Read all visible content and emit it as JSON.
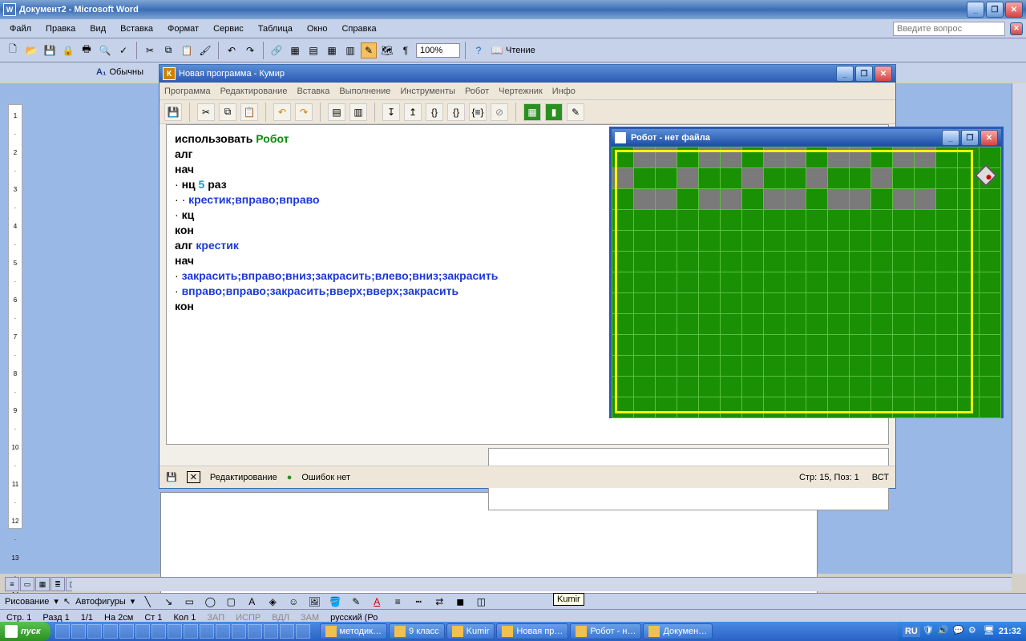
{
  "word": {
    "title": "Документ2 - Microsoft Word",
    "menus": [
      "Файл",
      "Правка",
      "Вид",
      "Вставка",
      "Формат",
      "Сервис",
      "Таблица",
      "Окно",
      "Справка"
    ],
    "help_placeholder": "Введите вопрос",
    "zoom": "100%",
    "reading": "Чтение",
    "format_style": "Обычны",
    "draw_label": "Рисование",
    "draw_autoshapes": "Автофигуры",
    "status": {
      "page": "Стр. 1",
      "sec": "Разд 1",
      "pages": "1/1",
      "at": "На 2см",
      "line": "Ст 1",
      "col": "Кол 1",
      "rec": "ЗАП",
      "trk": "ИСПР",
      "ext": "ВДЛ",
      "ovr": "ЗАМ",
      "lang": "русский (Ро",
      "tooltip": "Kumir"
    }
  },
  "kumir": {
    "title": "Новая программа - Кумир",
    "menus": [
      "Программа",
      "Редактирование",
      "Вставка",
      "Выполнение",
      "Инструменты",
      "Робот",
      "Чертежник",
      "Инфо"
    ],
    "code": {
      "l1_kw": "использовать",
      "l1_name": "Робот",
      "l2": "алг",
      "l3": "нач",
      "l4_kw": "нц",
      "l4_num": "5",
      "l4_kw2": "раз",
      "l5": "крестик;вправо;вправо",
      "l6": "кц",
      "l7": "кон",
      "l8_kw": "алг",
      "l8_name": "крестик",
      "l9": "нач",
      "l10": "закрасить;вправо;вниз;закрасить;влево;вниз;закрасить",
      "l11": "вправо;вправо;закрасить;вверх;вверх;закрасить",
      "l12": "кон"
    },
    "status": {
      "mode": "Редактирование",
      "errors": "Ошибок нет",
      "pos": "Стр: 15, Поз: 1",
      "ins": "ВСТ"
    }
  },
  "robot": {
    "title": "Робот - нет файла",
    "grid": {
      "rows": 13,
      "cols": 18
    },
    "painted": [
      [
        0,
        1
      ],
      [
        0,
        2
      ],
      [
        0,
        4
      ],
      [
        0,
        5
      ],
      [
        0,
        7
      ],
      [
        0,
        8
      ],
      [
        0,
        10
      ],
      [
        0,
        11
      ],
      [
        0,
        13
      ],
      [
        0,
        14
      ],
      [
        1,
        0
      ],
      [
        1,
        3
      ],
      [
        1,
        6
      ],
      [
        1,
        9
      ],
      [
        1,
        12
      ],
      [
        2,
        1
      ],
      [
        2,
        2
      ],
      [
        2,
        4
      ],
      [
        2,
        5
      ],
      [
        2,
        7
      ],
      [
        2,
        8
      ],
      [
        2,
        10
      ],
      [
        2,
        11
      ],
      [
        2,
        13
      ],
      [
        2,
        14
      ]
    ]
  },
  "taskbar": {
    "start": "пуск",
    "items": [
      "методик…",
      "9 класс",
      "Kumir",
      "Новая пр…",
      "Робот - н…",
      "Докумен…"
    ],
    "lang": "RU",
    "time": "21:32"
  }
}
